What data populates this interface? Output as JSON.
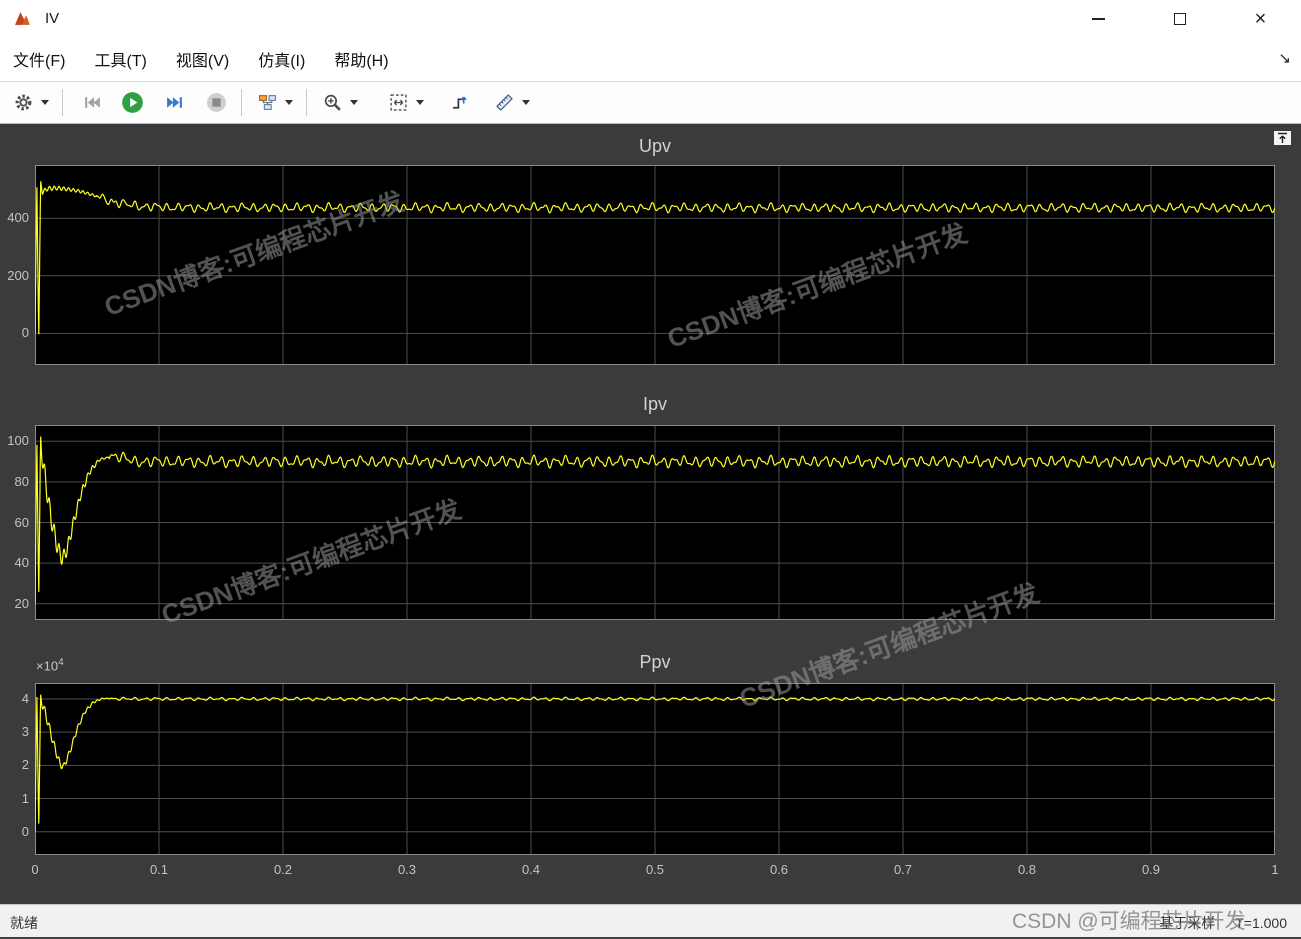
{
  "window": {
    "title": "IV",
    "controls": {
      "minimize": "minimize",
      "maximize": "maximize",
      "close": "×"
    }
  },
  "menu": {
    "items": [
      {
        "label": "文件(F)"
      },
      {
        "label": "工具(T)"
      },
      {
        "label": "视图(V)"
      },
      {
        "label": "仿真(I)"
      },
      {
        "label": "帮助(H)"
      }
    ],
    "corner_icon": "↘"
  },
  "toolbar": {
    "icons": [
      "gear-icon",
      "step-back-icon",
      "run-icon",
      "step-forward-icon",
      "stop-icon",
      "signal-selector-icon",
      "zoom-in-icon",
      "fit-to-view-icon",
      "trigger-icon",
      "measurements-icon"
    ]
  },
  "statusbar": {
    "ready": "就绪",
    "sample_mode": "基于采样",
    "time": "T=1.000"
  },
  "watermarks": {
    "plot_text": "CSDN博客:可编程芯片开发",
    "status_text": "CSDN @可编程芯片开发"
  },
  "chart_data": [
    {
      "type": "line",
      "title": "Upv",
      "x_range": [
        0,
        1
      ],
      "ylim": [
        -110,
        585
      ],
      "yticks": [
        {
          "v": 0,
          "l": "0"
        },
        {
          "v": 200,
          "l": "200"
        },
        {
          "v": 400,
          "l": "400"
        }
      ],
      "xticks": [
        {
          "v": 0,
          "l": "0"
        },
        {
          "v": 0.1,
          "l": "0.1"
        },
        {
          "v": 0.2,
          "l": "0.2"
        },
        {
          "v": 0.3,
          "l": "0.3"
        },
        {
          "v": 0.4,
          "l": "0.4"
        },
        {
          "v": 0.5,
          "l": "0.5"
        },
        {
          "v": 0.6,
          "l": "0.6"
        },
        {
          "v": 0.7,
          "l": "0.7"
        },
        {
          "v": 0.8,
          "l": "0.8"
        },
        {
          "v": 0.9,
          "l": "0.9"
        },
        {
          "v": 1,
          "l": "1"
        }
      ],
      "show_x_labels": false,
      "grid": true,
      "bg": "#000000",
      "grid_color": "#4e4e4e",
      "border_color": "#8c8c8c",
      "line_color": "#ffff21",
      "series": [
        {
          "name": "Upv",
          "keypoints": [
            [
              0,
              0
            ],
            [
              0.0015,
              520
            ],
            [
              0.003,
              -30
            ],
            [
              0.0045,
              530
            ],
            [
              0.006,
              490
            ],
            [
              0.01,
              503
            ],
            [
              0.018,
              505
            ],
            [
              0.028,
              500
            ],
            [
              0.038,
              492
            ],
            [
              0.05,
              476
            ],
            [
              0.062,
              458
            ],
            [
              0.075,
              447
            ],
            [
              0.09,
              440
            ],
            [
              0.12,
              437
            ],
            [
              1,
              436
            ]
          ],
          "ripple": {
            "start": 0.05,
            "amp": 18,
            "freq": 115
          },
          "transient": {
            "from": 0.005,
            "to": 0.09,
            "amp": 8,
            "freq": 260
          }
        }
      ]
    },
    {
      "type": "line",
      "title": "Ipv",
      "x_range": [
        0,
        1
      ],
      "ylim": [
        12,
        108
      ],
      "yticks": [
        {
          "v": 20,
          "l": "20"
        },
        {
          "v": 40,
          "l": "40"
        },
        {
          "v": 60,
          "l": "60"
        },
        {
          "v": 80,
          "l": "80"
        },
        {
          "v": 100,
          "l": "100"
        }
      ],
      "xticks": [
        {
          "v": 0,
          "l": "0"
        },
        {
          "v": 0.1,
          "l": "0.1"
        },
        {
          "v": 0.2,
          "l": "0.2"
        },
        {
          "v": 0.3,
          "l": "0.3"
        },
        {
          "v": 0.4,
          "l": "0.4"
        },
        {
          "v": 0.5,
          "l": "0.5"
        },
        {
          "v": 0.6,
          "l": "0.6"
        },
        {
          "v": 0.7,
          "l": "0.7"
        },
        {
          "v": 0.8,
          "l": "0.8"
        },
        {
          "v": 0.9,
          "l": "0.9"
        },
        {
          "v": 1,
          "l": "1"
        }
      ],
      "show_x_labels": false,
      "grid": true,
      "bg": "#000000",
      "grid_color": "#4e4e4e",
      "border_color": "#8c8c8c",
      "line_color": "#ffff21",
      "series": [
        {
          "name": "Ipv",
          "keypoints": [
            [
              0,
              20
            ],
            [
              0.0015,
              100
            ],
            [
              0.003,
              22
            ],
            [
              0.0045,
              100
            ],
            [
              0.006,
              92
            ],
            [
              0.009,
              78
            ],
            [
              0.013,
              62
            ],
            [
              0.018,
              48
            ],
            [
              0.022,
              42
            ],
            [
              0.026,
              47
            ],
            [
              0.031,
              60
            ],
            [
              0.037,
              74
            ],
            [
              0.044,
              85
            ],
            [
              0.052,
              91
            ],
            [
              0.065,
              93
            ],
            [
              0.08,
              90
            ],
            [
              1,
              90
            ]
          ],
          "ripple": {
            "start": 0.06,
            "amp": 3.2,
            "freq": 115
          },
          "transient": {
            "from": 0.004,
            "to": 0.06,
            "amp": 5,
            "freq": 260
          }
        }
      ]
    },
    {
      "type": "line",
      "title": "Ppv",
      "x_range": [
        0,
        1
      ],
      "ylim": [
        -7000,
        44800
      ],
      "y_exponent": {
        "base": "×10",
        "exp": "4"
      },
      "yticks": [
        {
          "v": 0,
          "l": "0"
        },
        {
          "v": 10000,
          "l": "1"
        },
        {
          "v": 20000,
          "l": "2"
        },
        {
          "v": 30000,
          "l": "3"
        },
        {
          "v": 40000,
          "l": "4"
        }
      ],
      "xticks": [
        {
          "v": 0,
          "l": "0"
        },
        {
          "v": 0.1,
          "l": "0.1"
        },
        {
          "v": 0.2,
          "l": "0.2"
        },
        {
          "v": 0.3,
          "l": "0.3"
        },
        {
          "v": 0.4,
          "l": "0.4"
        },
        {
          "v": 0.5,
          "l": "0.5"
        },
        {
          "v": 0.6,
          "l": "0.6"
        },
        {
          "v": 0.7,
          "l": "0.7"
        },
        {
          "v": 0.8,
          "l": "0.8"
        },
        {
          "v": 0.9,
          "l": "0.9"
        },
        {
          "v": 1,
          "l": "1"
        }
      ],
      "show_x_labels": true,
      "grid": true,
      "bg": "#000000",
      "grid_color": "#4e4e4e",
      "border_color": "#8c8c8c",
      "line_color": "#ffff21",
      "series": [
        {
          "name": "Ppv",
          "keypoints": [
            [
              0,
              0
            ],
            [
              0.0015,
              41500
            ],
            [
              0.003,
              500
            ],
            [
              0.0045,
              40500
            ],
            [
              0.006,
              38500
            ],
            [
              0.01,
              33500
            ],
            [
              0.015,
              26500
            ],
            [
              0.02,
              20500
            ],
            [
              0.023,
              19500
            ],
            [
              0.028,
              24000
            ],
            [
              0.034,
              31000
            ],
            [
              0.04,
              36000
            ],
            [
              0.047,
              39000
            ],
            [
              0.055,
              40200
            ],
            [
              0.07,
              40000
            ],
            [
              1,
              40000
            ]
          ],
          "ripple": {
            "start": 0.06,
            "amp": 550,
            "freq": 115
          },
          "transient": {
            "from": 0.004,
            "to": 0.06,
            "amp": 1500,
            "freq": 260
          }
        }
      ]
    }
  ]
}
